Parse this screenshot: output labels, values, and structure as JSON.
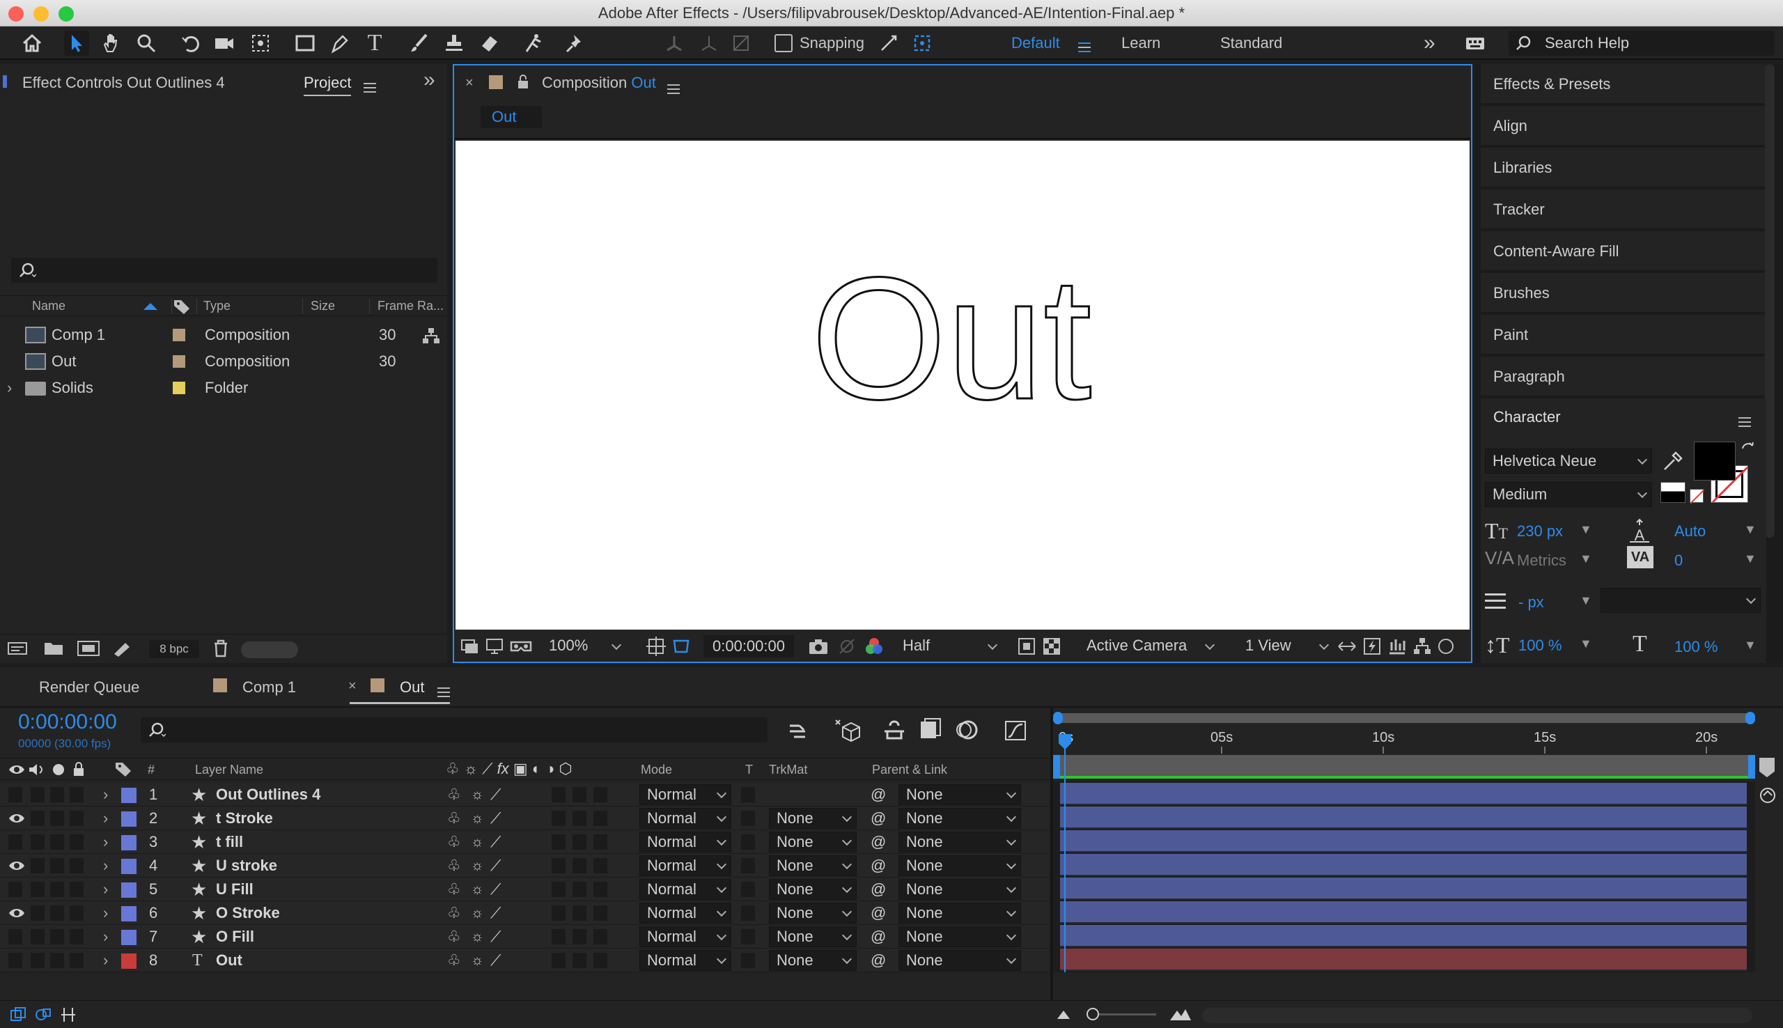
{
  "window": {
    "title": "Adobe After Effects - /Users/filipvabrousek/Desktop/Advanced-AE/Intention-Final.aep *"
  },
  "toolbar": {
    "snapping_label": "Snapping",
    "workspaces": [
      "Default",
      "Learn",
      "Standard"
    ],
    "active_workspace": "Default",
    "search_placeholder": "Search Help"
  },
  "left_panel": {
    "tab_effect_controls": "Effect Controls Out Outlines 4",
    "tab_project": "Project",
    "columns": {
      "name": "Name",
      "type": "Type",
      "size": "Size",
      "frame_rate": "Frame Ra..."
    },
    "items": [
      {
        "name": "Comp 1",
        "type": "Composition",
        "frame_rate": "30",
        "color": "#b49a7a"
      },
      {
        "name": "Out",
        "type": "Composition",
        "frame_rate": "30",
        "color": "#b49a7a"
      },
      {
        "name": "Solids",
        "type": "Folder",
        "frame_rate": "",
        "color": "#e3cf5a"
      }
    ],
    "bpc_label": "8 bpc"
  },
  "composition": {
    "tab_prefix": "Composition",
    "tab_name": "Out",
    "breadcrumb": "Out",
    "canvas_text": "Out",
    "zoom": "100%",
    "timecode": "0:00:00:00",
    "resolution": "Half",
    "camera": "Active Camera",
    "views": "1 View"
  },
  "right_panel": {
    "items": [
      "Effects & Presets",
      "Align",
      "Libraries",
      "Tracker",
      "Content-Aware Fill",
      "Brushes",
      "Paint",
      "Paragraph"
    ],
    "character": {
      "title": "Character",
      "font": "Helvetica Neue",
      "style": "Medium",
      "size": "230 px",
      "leading": "Auto",
      "kerning": "Metrics",
      "tracking": "0",
      "stroke_width": "- px",
      "vscale": "100 %",
      "hscale": "100 %"
    }
  },
  "timeline": {
    "tabs": [
      "Render Queue",
      "Comp 1",
      "Out"
    ],
    "active_tab": "Out",
    "timecode": "0:00:00:00",
    "frames": "00000 (30.00 fps)",
    "columns": {
      "num": "#",
      "layer_name": "Layer Name",
      "mode": "Mode",
      "t": "T",
      "trkmat": "TrkMat",
      "parent": "Parent & Link"
    },
    "ruler": [
      "0s",
      "05s",
      "10s",
      "15s",
      "20s"
    ],
    "layers": [
      {
        "num": "1",
        "name": "Out Outlines 4",
        "kind": "shape",
        "visible": false,
        "mode": "Normal",
        "trkmat": "",
        "parent": "None",
        "color": "#6878d6",
        "bar": "#4e5a98"
      },
      {
        "num": "2",
        "name": "t Stroke",
        "kind": "shape",
        "visible": true,
        "mode": "Normal",
        "trkmat": "None",
        "parent": "None",
        "color": "#6878d6",
        "bar": "#4e5a98"
      },
      {
        "num": "3",
        "name": "t fill",
        "kind": "shape",
        "visible": false,
        "mode": "Normal",
        "trkmat": "None",
        "parent": "None",
        "color": "#6878d6",
        "bar": "#4e5a98"
      },
      {
        "num": "4",
        "name": "U stroke",
        "kind": "shape",
        "visible": true,
        "mode": "Normal",
        "trkmat": "None",
        "parent": "None",
        "color": "#6878d6",
        "bar": "#4e5a98"
      },
      {
        "num": "5",
        "name": "U Fill",
        "kind": "shape",
        "visible": false,
        "mode": "Normal",
        "trkmat": "None",
        "parent": "None",
        "color": "#6878d6",
        "bar": "#4e5a98"
      },
      {
        "num": "6",
        "name": "O Stroke",
        "kind": "shape",
        "visible": true,
        "mode": "Normal",
        "trkmat": "None",
        "parent": "None",
        "color": "#6878d6",
        "bar": "#4e5a98"
      },
      {
        "num": "7",
        "name": "O Fill",
        "kind": "shape",
        "visible": false,
        "mode": "Normal",
        "trkmat": "None",
        "parent": "None",
        "color": "#6878d6",
        "bar": "#4e5a98"
      },
      {
        "num": "8",
        "name": "Out",
        "kind": "text",
        "visible": false,
        "mode": "Normal",
        "trkmat": "None",
        "parent": "None",
        "color": "#c83c3c",
        "bar": "#7d3a3e"
      }
    ]
  }
}
